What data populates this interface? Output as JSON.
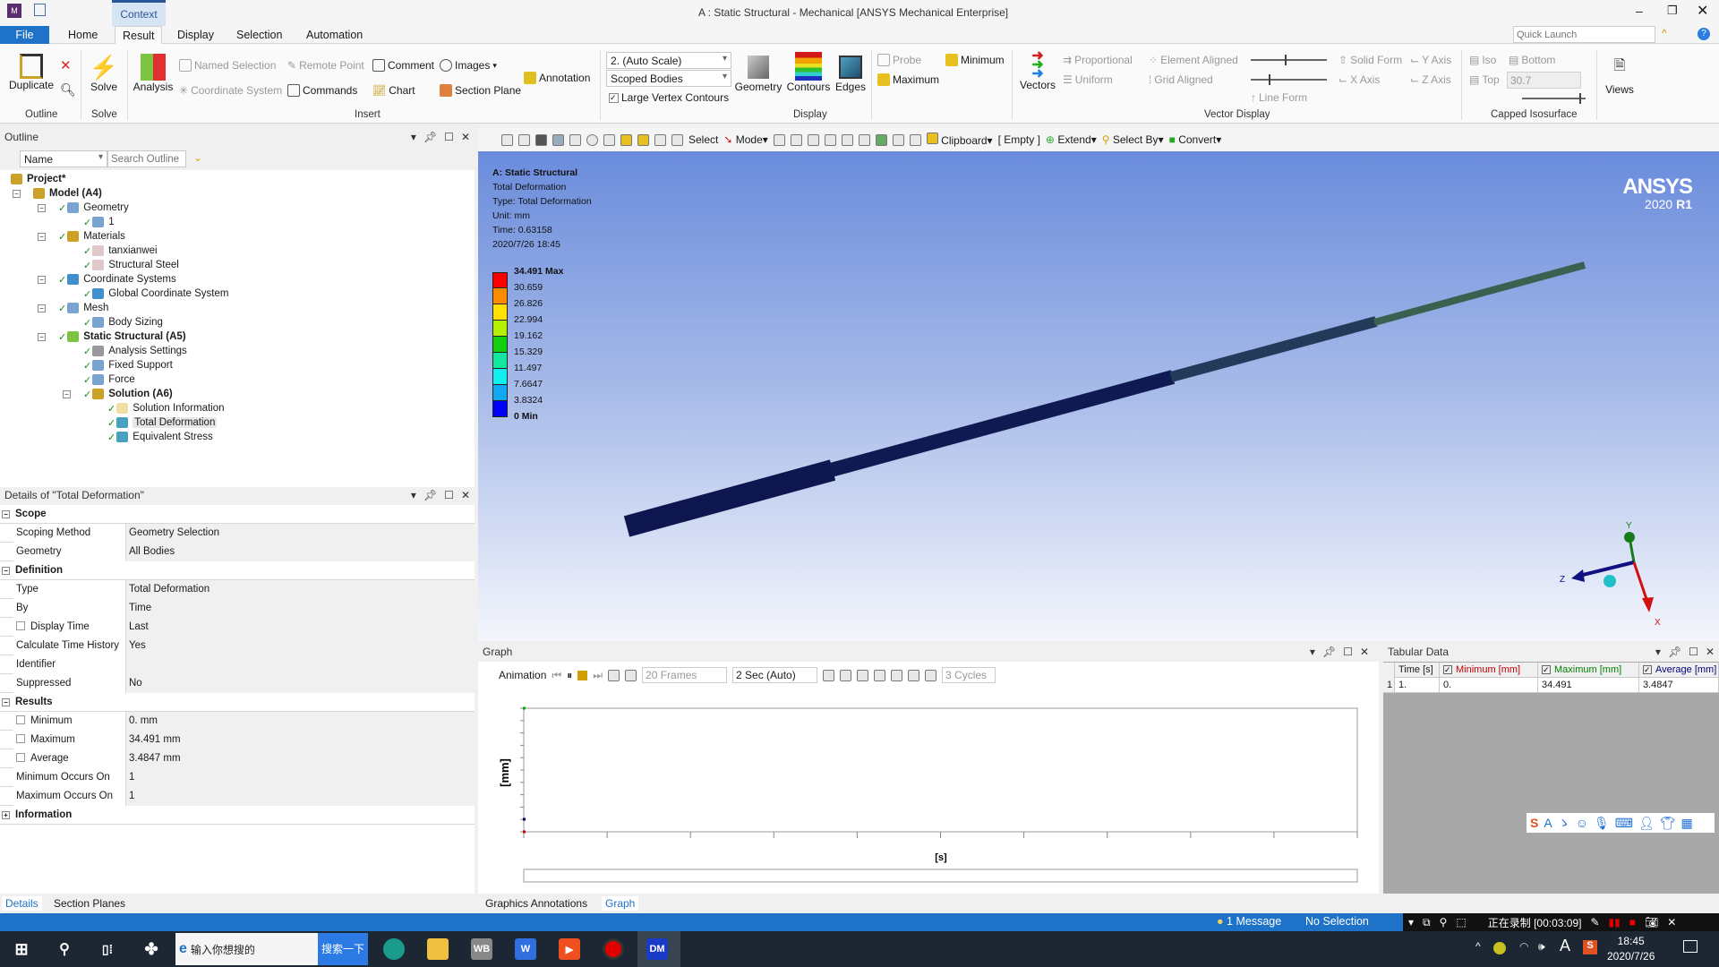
{
  "window": {
    "title": "A : Static Structural - Mechanical [ANSYS Mechanical Enterprise]",
    "context_tab": "Context"
  },
  "menu_tabs": [
    "File",
    "Home",
    "Result",
    "Display",
    "Selection",
    "Automation"
  ],
  "active_tab": "Result",
  "quick_launch_placeholder": "Quick Launch",
  "ribbon": {
    "outline": {
      "duplicate": "Duplicate",
      "group": "Outline"
    },
    "solve": {
      "solve": "Solve",
      "group": "Solve"
    },
    "insert": {
      "analysis": "Analysis",
      "named_selection": "Named Selection",
      "coordinate_system": "Coordinate System",
      "remote_point": "Remote Point",
      "commands": "Commands",
      "comment": "Comment",
      "chart": "Chart",
      "images": "Images",
      "section_plane": "Section Plane",
      "annotation": "Annotation",
      "group": "Insert"
    },
    "display": {
      "scale": "2. (Auto Scale)",
      "bodies": "Scoped Bodies",
      "large_vertex_contours": "Large Vertex Contours",
      "large_vertex_checked": true,
      "geometry": "Geometry",
      "contours": "Contours",
      "edges": "Edges",
      "group": "Display"
    },
    "probe": {
      "probe": "Probe",
      "maximum": "Maximum",
      "minimum": "Minimum"
    },
    "vector": {
      "vectors": "Vectors",
      "proportional": "Proportional",
      "uniform": "Uniform",
      "element_aligned": "Element Aligned",
      "grid_aligned": "Grid Aligned",
      "line_form": "Line Form",
      "solid_form": "Solid Form",
      "x_axis": "X Axis",
      "y_axis": "Y Axis",
      "z_axis": "Z Axis",
      "group": "Vector Display"
    },
    "capped": {
      "iso": "Iso",
      "top": "Top",
      "bottom": "Bottom",
      "value": "30.7",
      "group": "Capped Isosurface"
    },
    "views": "Views"
  },
  "graphics_toolbar": {
    "select": "Select",
    "mode": "Mode",
    "clipboard": "Clipboard",
    "empty": "[ Empty ]",
    "extend": "Extend",
    "select_by": "Select By",
    "convert": "Convert"
  },
  "outline": {
    "title": "Outline",
    "filter": "Name",
    "search_placeholder": "Search Outline",
    "tree": [
      {
        "label": "Project*",
        "level": 0,
        "bold": true,
        "icon": "project-icon"
      },
      {
        "label": "Model (A4)",
        "level": 1,
        "bold": true,
        "icon": "model-icon",
        "expanded": true
      },
      {
        "label": "Geometry",
        "level": 2,
        "icon": "geometry-icon",
        "expanded": true
      },
      {
        "label": "1",
        "level": 3,
        "icon": "body-icon"
      },
      {
        "label": "Materials",
        "level": 2,
        "icon": "materials-icon",
        "expanded": true
      },
      {
        "label": "tanxianwei",
        "level": 3,
        "icon": "material-icon"
      },
      {
        "label": "Structural Steel",
        "level": 3,
        "icon": "material-icon"
      },
      {
        "label": "Coordinate Systems",
        "level": 2,
        "icon": "coordinate-systems-icon",
        "expanded": true
      },
      {
        "label": "Global Coordinate System",
        "level": 3,
        "icon": "coordinate-system-icon"
      },
      {
        "label": "Mesh",
        "level": 2,
        "icon": "mesh-icon",
        "expanded": true
      },
      {
        "label": "Body Sizing",
        "level": 3,
        "icon": "sizing-icon"
      },
      {
        "label": "Static Structural (A5)",
        "level": 2,
        "bold": true,
        "icon": "static-structural-icon",
        "expanded": true
      },
      {
        "label": "Analysis Settings",
        "level": 3,
        "icon": "analysis-settings-icon"
      },
      {
        "label": "Fixed Support",
        "level": 3,
        "icon": "fixed-support-icon"
      },
      {
        "label": "Force",
        "level": 3,
        "icon": "force-icon"
      },
      {
        "label": "Solution (A6)",
        "level": 3,
        "bold": true,
        "icon": "solution-icon",
        "expanded": true
      },
      {
        "label": "Solution Information",
        "level": 4,
        "icon": "solution-information-icon"
      },
      {
        "label": "Total Deformation",
        "level": 4,
        "icon": "result-icon",
        "selected": true
      },
      {
        "label": "Equivalent Stress",
        "level": 4,
        "icon": "result-icon"
      }
    ]
  },
  "details": {
    "title": "Details of \"Total Deformation\"",
    "rows": [
      {
        "label": "Scope",
        "header": true
      },
      {
        "label": "Scoping Method",
        "value": "Geometry Selection"
      },
      {
        "label": "Geometry",
        "value": "All Bodies"
      },
      {
        "label": "Definition",
        "header": true
      },
      {
        "label": "Type",
        "value": "Total Deformation"
      },
      {
        "label": "By",
        "value": "Time"
      },
      {
        "label": "Display Time",
        "value": "Last",
        "checkbox": true
      },
      {
        "label": "Calculate Time History",
        "value": "Yes"
      },
      {
        "label": "Identifier",
        "value": ""
      },
      {
        "label": "Suppressed",
        "value": "No"
      },
      {
        "label": "Results",
        "header": true
      },
      {
        "label": "Minimum",
        "value": "0. mm",
        "checkbox": true
      },
      {
        "label": "Maximum",
        "value": "34.491 mm",
        "checkbox": true
      },
      {
        "label": "Average",
        "value": "3.4847 mm",
        "checkbox": true
      },
      {
        "label": "Minimum Occurs On",
        "value": "1"
      },
      {
        "label": "Maximum Occurs On",
        "value": "1"
      },
      {
        "label": "Information",
        "header": true,
        "collapsed": true
      }
    ]
  },
  "viewport": {
    "title": "A: Static Structural",
    "lines": [
      "Total Deformation",
      "Type: Total Deformation",
      "Unit: mm",
      "Time: 0.63158",
      "2020/7/26 18:45"
    ],
    "legend": {
      "labels": [
        "34.491 Max",
        "30.659",
        "26.826",
        "22.994",
        "19.162",
        "15.329",
        "11.497",
        "7.6647",
        "3.8324",
        "0 Min"
      ],
      "colors": [
        "#ff0000",
        "#ff8c00",
        "#ffe000",
        "#b4f000",
        "#10d010",
        "#10e8a0",
        "#10f0f0",
        "#10a8f0",
        "#0000ff"
      ]
    },
    "logo": {
      "brand": "ANSYS",
      "version": "2020",
      "release": "R1"
    },
    "triad": {
      "x": "X",
      "y": "Y",
      "z": "Z"
    }
  },
  "graph": {
    "title": "Graph",
    "animation": "Animation",
    "frames": "20 Frames",
    "duration": "2 Sec (Auto)",
    "cycles": "3 Cycles",
    "ylabel": "[mm]",
    "xlabel": "[s]"
  },
  "tabular": {
    "title": "Tabular Data",
    "columns": [
      "Time [s]",
      "Minimum [mm]",
      "Maximum [mm]",
      "Average [mm]"
    ],
    "column_colors": [
      "#1a1a1a",
      "#c00000",
      "#008000",
      "#000080"
    ],
    "rows": [
      [
        "1",
        "1.",
        "0.",
        "34.491",
        "3.4847"
      ]
    ]
  },
  "bottom_tabs": {
    "left": [
      "Details",
      "Section Planes"
    ],
    "right": [
      "Graphics Annotations",
      "Graph"
    ]
  },
  "status": {
    "messages": "1 Message",
    "selection": "No Selection",
    "recording": "正在录制 [00:03:09]"
  },
  "taskbar": {
    "search_placeholder": "输入你想搜的",
    "search_button": "搜索一下",
    "time": "18:45",
    "date": "2020/7/26",
    "apps": [
      "edge",
      "explorer",
      "WB",
      "wps",
      "media",
      "recorder",
      "DM"
    ]
  }
}
